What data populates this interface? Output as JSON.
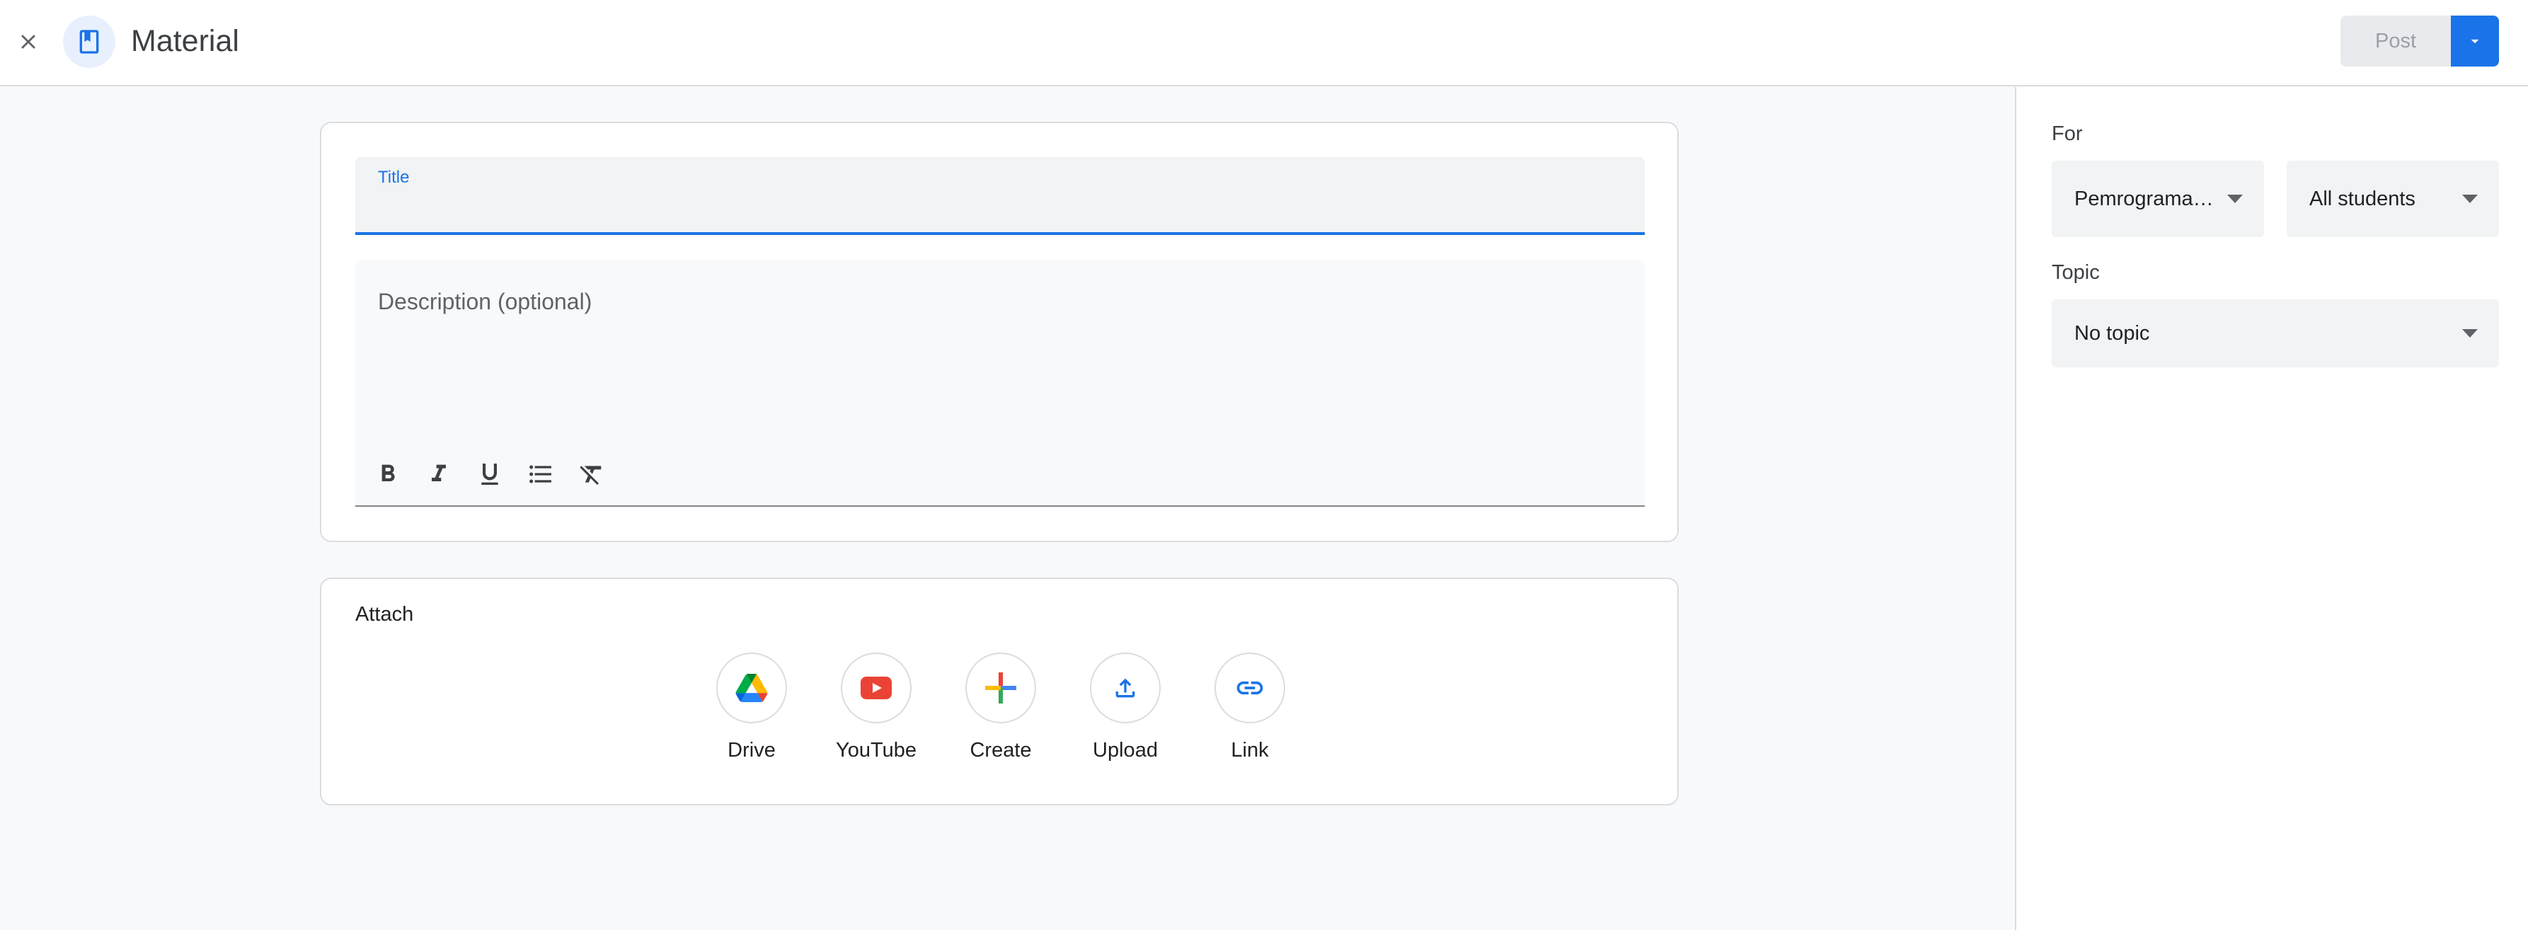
{
  "header": {
    "title": "Material",
    "post_label": "Post"
  },
  "form": {
    "title_label": "Title",
    "title_value": "",
    "description_placeholder": "Description (optional)",
    "description_value": ""
  },
  "attach": {
    "heading": "Attach",
    "items": [
      {
        "label": "Drive",
        "icon": "google-drive-icon"
      },
      {
        "label": "YouTube",
        "icon": "youtube-icon"
      },
      {
        "label": "Create",
        "icon": "plus-icon"
      },
      {
        "label": "Upload",
        "icon": "upload-icon"
      },
      {
        "label": "Link",
        "icon": "link-icon"
      }
    ]
  },
  "sidebar": {
    "for_label": "For",
    "class_selected": "Pemrograman Web",
    "students_selected": "All students",
    "topic_label": "Topic",
    "topic_selected": "No topic"
  },
  "colors": {
    "accent": "#1a73e8",
    "youtube_red": "#ea4335",
    "field_bg": "#f1f3f4",
    "border": "#dadce0"
  }
}
